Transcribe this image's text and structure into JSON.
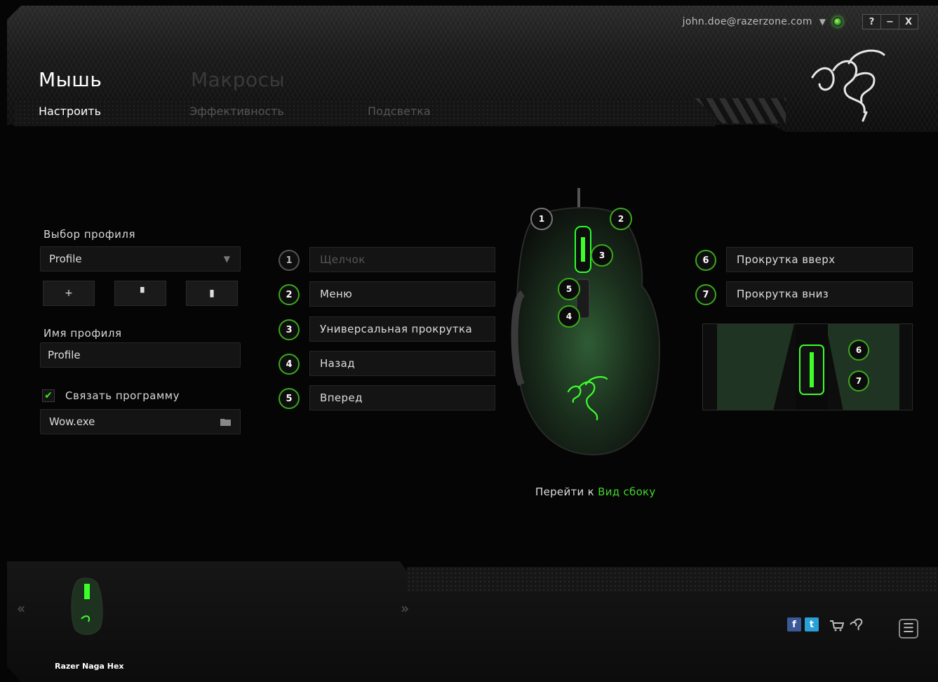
{
  "account": {
    "email": "john.doe@razerzone.com"
  },
  "window_buttons": {
    "help": "?",
    "minimize": "−",
    "close": "X"
  },
  "main_tabs": {
    "mouse": "Мышь",
    "macros": "Макросы"
  },
  "sub_tabs": {
    "customize": "Настроить",
    "performance": "Эффективность",
    "lighting": "Подсветка"
  },
  "profile": {
    "select_label": "Выбор профиля",
    "selected": "Profile",
    "add": "+",
    "copy": "▝",
    "delete": "▮",
    "name_label": "Имя профиля",
    "name_value": "Profile",
    "link_label": "Связать программу",
    "link_checked": true,
    "program": "Wow.exe"
  },
  "mappings": [
    {
      "num": "1",
      "label": "Щелчок"
    },
    {
      "num": "2",
      "label": "Меню"
    },
    {
      "num": "3",
      "label": "Универсальная прокрутка"
    },
    {
      "num": "4",
      "label": "Назад"
    },
    {
      "num": "5",
      "label": "Вперед"
    },
    {
      "num": "6",
      "label": "Прокрутка вверх"
    },
    {
      "num": "7",
      "label": "Прокрутка вниз"
    }
  ],
  "mouse_markers": [
    "1",
    "2",
    "3",
    "5",
    "4"
  ],
  "side_markers": [
    "6",
    "7"
  ],
  "goto": {
    "prefix": "Перейти к",
    "link": "Вид сбоку"
  },
  "footer": {
    "device": "Razer Naga Hex",
    "prev": "«",
    "next": "»",
    "menu": "☰",
    "social": {
      "facebook": "f",
      "twitter": "t"
    }
  },
  "colors": {
    "accent": "#44d62c",
    "bg": "#050505"
  }
}
